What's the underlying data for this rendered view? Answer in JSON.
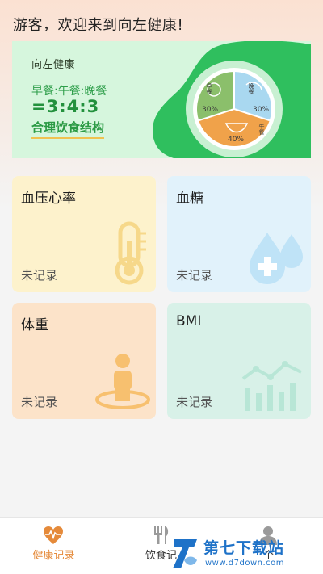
{
  "header": {
    "greeting": "游客，欢迎来到向左健康!"
  },
  "banner": {
    "brand": "向左健康",
    "meals": "早餐:午餐:晚餐",
    "ratio": "=3:4:3",
    "slogan": "合理饮食结构",
    "pie": {
      "slices": [
        {
          "meal": "早餐",
          "percent": "30%",
          "color": "#8bbf6b"
        },
        {
          "meal": "晚餐",
          "percent": "30%",
          "color": "#a9d8f0"
        },
        {
          "meal": "午餐",
          "percent": "40%",
          "color": "#f0a24a"
        }
      ]
    }
  },
  "cards": [
    {
      "title": "血压心率",
      "status": "未记录",
      "color": "#fdf2cc",
      "icon": "thermometer-icon"
    },
    {
      "title": "血糖",
      "status": "未记录",
      "color": "#e1f2fb",
      "icon": "blood-drop-icon"
    },
    {
      "title": "体重",
      "status": "未记录",
      "color": "#fce3c9",
      "icon": "person-scale-icon"
    },
    {
      "title": "BMI",
      "status": "未记录",
      "color": "#d8f1e8",
      "icon": "trend-chart-icon"
    }
  ],
  "tabbar": {
    "tabs": [
      {
        "label": "健康记录",
        "icon": "heart-pulse-icon",
        "active": true
      },
      {
        "label": "饮食记",
        "icon": "fork-knife-icon",
        "active": false
      },
      {
        "label": "个",
        "icon": "profile-icon",
        "active": false
      }
    ],
    "active_color": "#e58a3a"
  },
  "watermark": {
    "title": "第七下载站",
    "url": "www.d7down.com"
  }
}
